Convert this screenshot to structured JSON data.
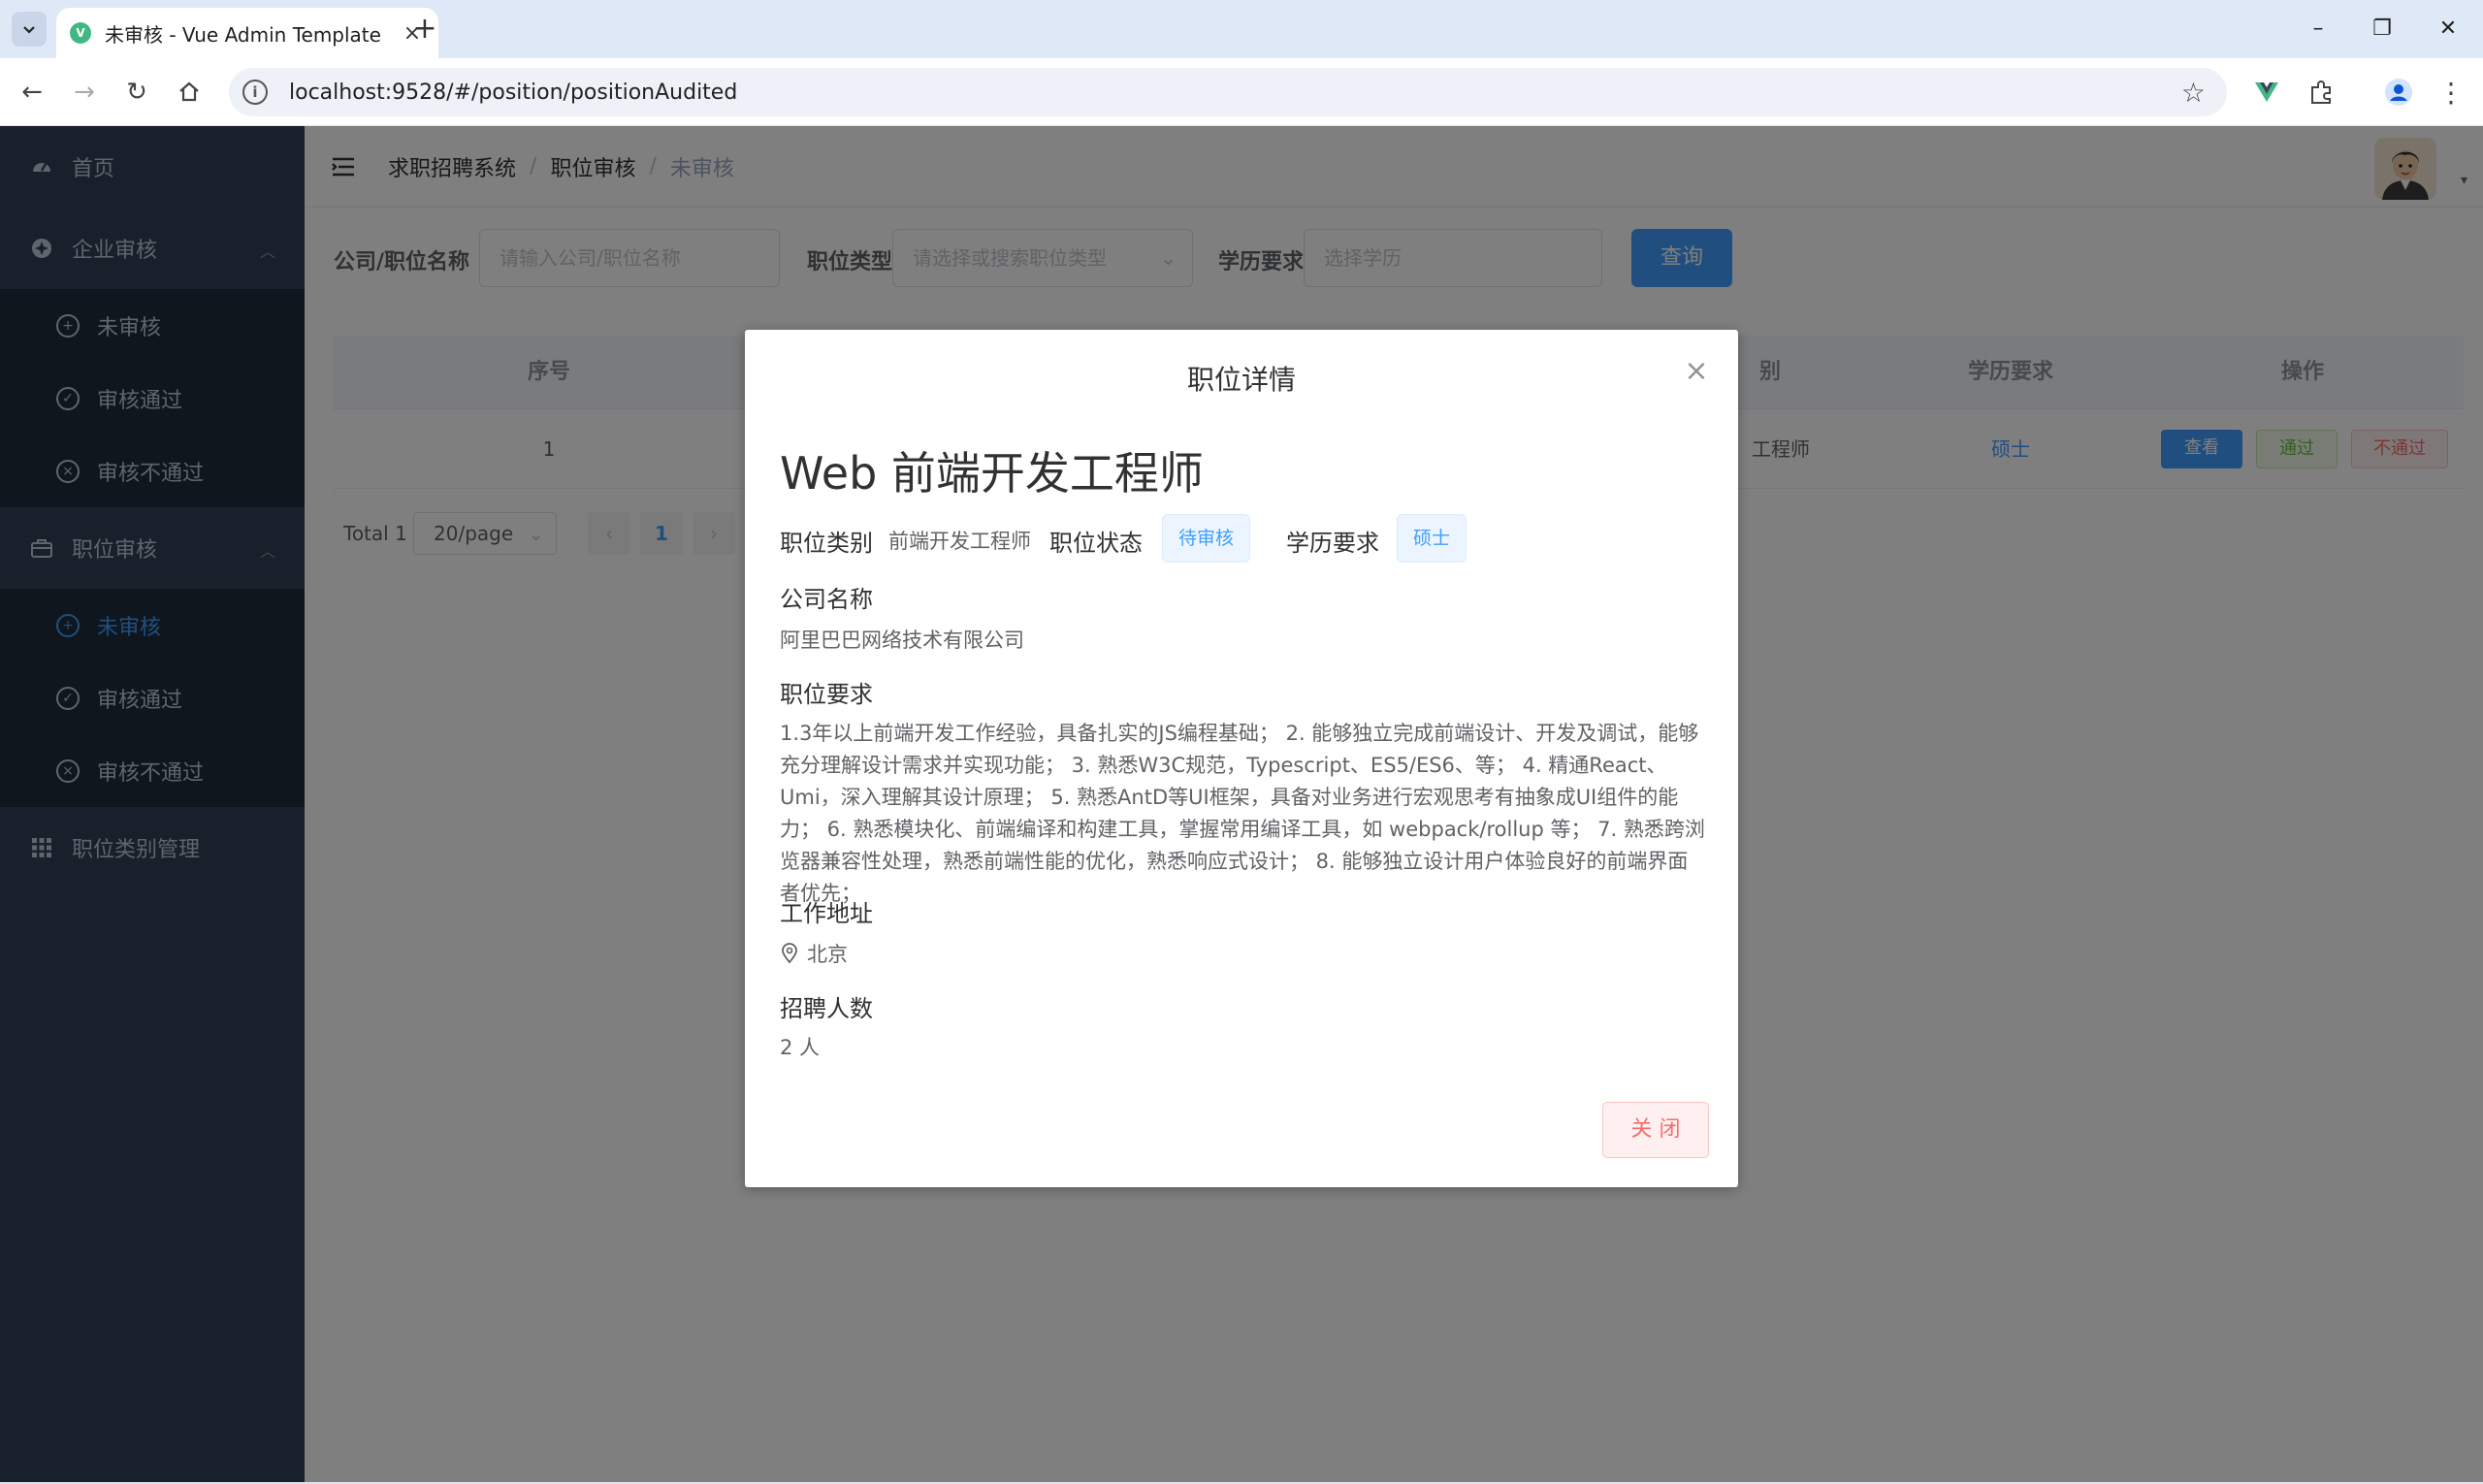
{
  "browser": {
    "tab_title": "未审核 - Vue Admin Template",
    "url": "localhost:9528/#/position/positionAudited"
  },
  "sidebar": {
    "items": [
      {
        "label": "首页",
        "icon": "dashboard-icon"
      },
      {
        "label": "企业审核",
        "icon": "company-audit-icon",
        "expanded": true,
        "children": [
          {
            "label": "未审核",
            "icon": "plus-circle-icon"
          },
          {
            "label": "审核通过",
            "icon": "check-circle-icon"
          },
          {
            "label": "审核不通过",
            "icon": "close-circle-icon"
          }
        ]
      },
      {
        "label": "职位审核",
        "icon": "briefcase-icon",
        "expanded": true,
        "children": [
          {
            "label": "未审核",
            "icon": "plus-circle-icon",
            "active": true
          },
          {
            "label": "审核通过",
            "icon": "check-circle-icon"
          },
          {
            "label": "审核不通过",
            "icon": "close-circle-icon"
          }
        ]
      },
      {
        "label": "职位类别管理",
        "icon": "grid-icon"
      }
    ]
  },
  "breadcrumb": [
    "求职招聘系统",
    "职位审核",
    "未审核"
  ],
  "filters": {
    "company_label": "公司/职位名称",
    "company_placeholder": "请输入公司/职位名称",
    "type_label": "职位类型",
    "type_placeholder": "请选择或搜索职位类型",
    "edu_label": "学历要求",
    "edu_placeholder": "选择学历",
    "query_button": "查询"
  },
  "table": {
    "columns": [
      "序号",
      "别",
      "学历要求",
      "操作"
    ],
    "rows": [
      {
        "index": "1",
        "category": "工程师",
        "education": "硕士",
        "view": "查看",
        "pass": "通过",
        "reject": "不通过"
      }
    ]
  },
  "pagination": {
    "total": "Total 1",
    "page_size": "20/page",
    "current": "1"
  },
  "dialog": {
    "title": "职位详情",
    "job_name": "Web 前端开发工程师",
    "category_label": "职位类别",
    "category_value": "前端开发工程师",
    "status_label": "职位状态",
    "status_value": "待审核",
    "edu_label": "学历要求",
    "edu_value": "硕士",
    "company_label": "公司名称",
    "company_value": "阿里巴巴网络技术有限公司",
    "requirements_label": "职位要求",
    "requirements": "1.3年以上前端开发工作经验，具备扎实的JS编程基础； 2. 能够独立完成前端设计、开发及调试，能够充分理解设计需求并实现功能； 3. 熟悉W3C规范，Typescript、ES5/ES6、等； 4. 精通React、Umi，深入理解其设计原理； 5. 熟悉AntD等UI框架，具备对业务进行宏观思考有抽象成UI组件的能力； 6. 熟悉模块化、前端编译和构建工具，掌握常用编译工具，如 webpack/rollup 等； 7. 熟悉跨浏览器兼容性处理，熟悉前端性能的优化，熟悉响应式设计； 8. 能够独立设计用户体验良好的前端界面者优先；",
    "address_label": "工作地址",
    "address_value": "北京",
    "headcount_label": "招聘人数",
    "headcount_value": "2 人",
    "close_button": "关 闭"
  },
  "colors": {
    "primary": "#409eff",
    "danger": "#f56c6c",
    "success": "#67c23a",
    "sidebar_bg": "#304156"
  }
}
